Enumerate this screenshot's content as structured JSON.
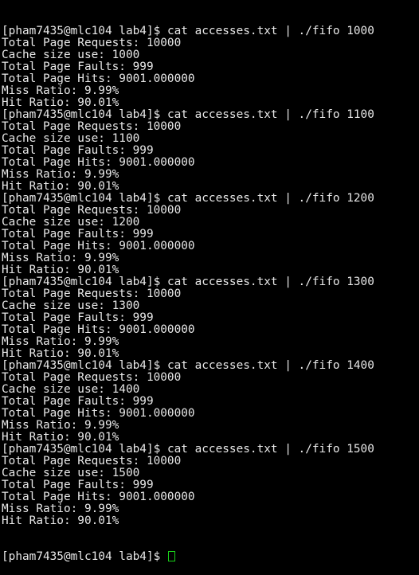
{
  "terminal": {
    "prompt": "[pham7435@mlc104 lab4]$ ",
    "runs": [
      {
        "command": "cat accesses.txt | ./fifo 1000",
        "output": [
          "Total Page Requests: 10000",
          "Cache size use: 1000",
          "Total Page Faults: 999",
          "Total Page Hits: 9001.000000",
          "Miss Ratio: 9.99%",
          "Hit Ratio: 90.01%"
        ]
      },
      {
        "command": "cat accesses.txt | ./fifo 1100",
        "output": [
          "Total Page Requests: 10000",
          "Cache size use: 1100",
          "Total Page Faults: 999",
          "Total Page Hits: 9001.000000",
          "Miss Ratio: 9.99%",
          "Hit Ratio: 90.01%"
        ]
      },
      {
        "command": "cat accesses.txt | ./fifo 1200",
        "output": [
          "Total Page Requests: 10000",
          "Cache size use: 1200",
          "Total Page Faults: 999",
          "Total Page Hits: 9001.000000",
          "Miss Ratio: 9.99%",
          "Hit Ratio: 90.01%"
        ]
      },
      {
        "command": "cat accesses.txt | ./fifo 1300",
        "output": [
          "Total Page Requests: 10000",
          "Cache size use: 1300",
          "Total Page Faults: 999",
          "Total Page Hits: 9001.000000",
          "Miss Ratio: 9.99%",
          "Hit Ratio: 90.01%"
        ]
      },
      {
        "command": "cat accesses.txt | ./fifo 1400",
        "output": [
          "Total Page Requests: 10000",
          "Cache size use: 1400",
          "Total Page Faults: 999",
          "Total Page Hits: 9001.000000",
          "Miss Ratio: 9.99%",
          "Hit Ratio: 90.01%"
        ]
      },
      {
        "command": "cat accesses.txt | ./fifo 1500",
        "output": [
          "Total Page Requests: 10000",
          "Cache size use: 1500",
          "Total Page Faults: 999",
          "Total Page Hits: 9001.000000",
          "Miss Ratio: 9.99%",
          "Hit Ratio: 90.01%"
        ]
      }
    ],
    "final_prompt": "[pham7435@mlc104 lab4]$ ",
    "colors": {
      "background": "#000000",
      "text": "#e8e8e8",
      "cursor": "#19d119"
    }
  }
}
